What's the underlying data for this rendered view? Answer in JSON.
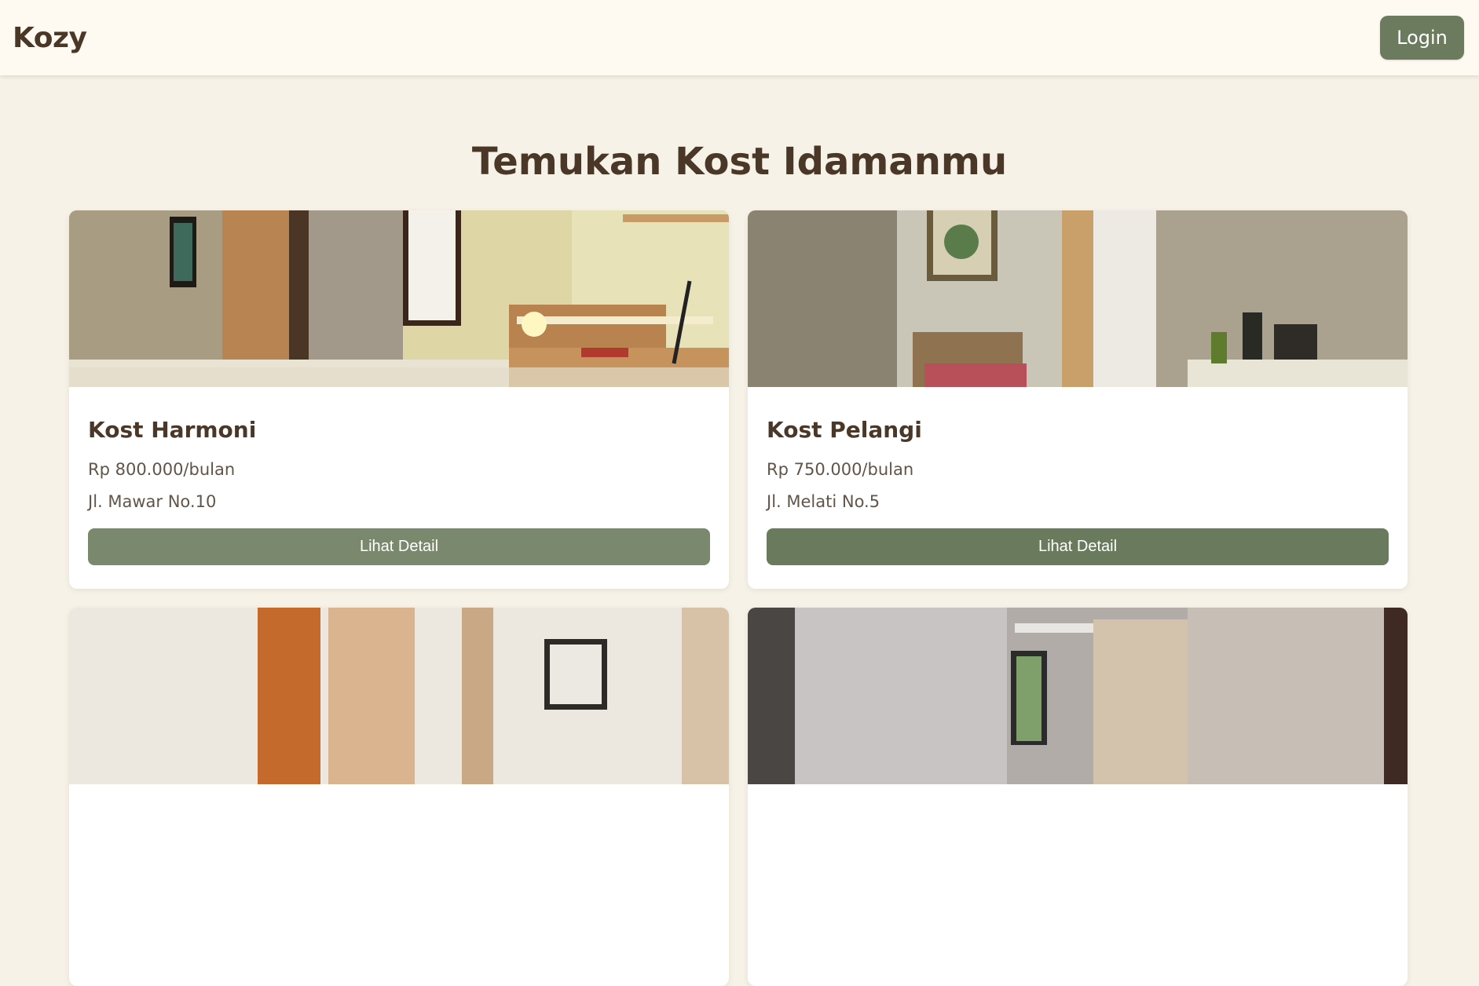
{
  "navbar": {
    "brand": "Kozy",
    "login_label": "Login"
  },
  "hero": {
    "title": "Temukan Kost Idamanmu"
  },
  "listings": [
    {
      "name": "Kost Harmoni",
      "price": "Rp 800.000/bulan",
      "address": "Jl. Mawar No.10",
      "button_label": "Lihat Detail"
    },
    {
      "name": "Kost Pelangi",
      "price": "Rp 750.000/bulan",
      "address": "Jl. Melati No.5",
      "button_label": "Lihat Detail"
    }
  ],
  "colors": {
    "background": "#f7f2e7",
    "navbar": "#fffaf1",
    "text_brown": "#4a3728",
    "accent_green": "#6c7b5d"
  }
}
